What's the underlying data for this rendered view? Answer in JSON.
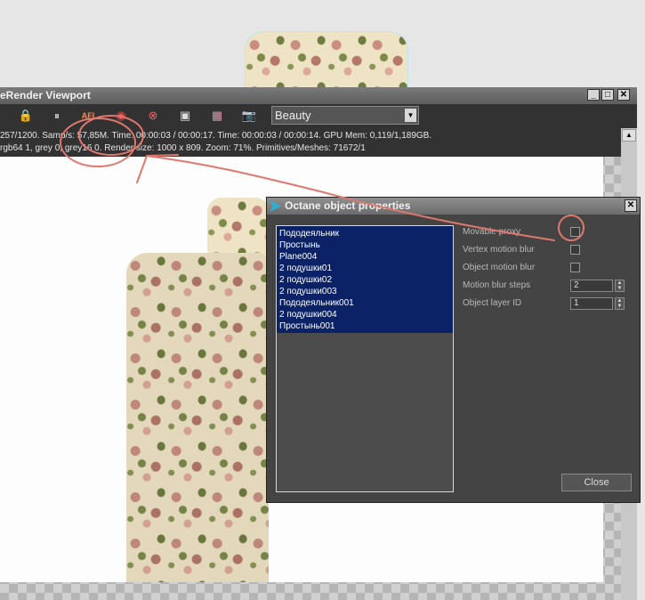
{
  "viewport": {
    "title": "eRender Viewport",
    "window_buttons": [
      "_",
      "□",
      "✕"
    ],
    "toolbar_icons": [
      "lock-icon",
      "pause-icon",
      "afi-icon",
      "color-wheel-icon",
      "no-region-icon",
      "monitor-icon",
      "film-icon",
      "camera-icon"
    ],
    "toolbar_glyphs": {
      "lock": "🔒",
      "pause": "⏸",
      "afi": "AFI",
      "color": "◉",
      "region": "⊗",
      "monitor": "▣",
      "film": "▦",
      "camera": "📷"
    },
    "pass_select": {
      "value": "Beauty",
      "arrow": "▼"
    },
    "status_line1": "257/1200.   Samp/s: 57,85M.   Time: 00:00:03 / 00:00:17.   Time: 00:00:03 / 00:00:14.   GPU Mem: 0,119/1,189GB.",
    "status_line2": "rgb64 1, grey 0, grey16 0.   Render size: 1000 x 809.   Zoom: 71%.   Primitives/Meshes: 71672/1",
    "scroll_up": "▲"
  },
  "dialog": {
    "title": "Octane object properties",
    "close_glyph": "✕",
    "objects": [
      "Пододеяльник",
      "Простынь",
      "Plane004",
      "2 подушки01",
      "2 подушки02",
      "2 подушки003",
      "Пододеяльник001",
      "2 подушки004",
      "Простынь001"
    ],
    "properties": {
      "movable_proxy": "Movable proxy",
      "vertex_motion_blur": "Vertex motion blur",
      "object_motion_blur": "Object motion blur",
      "motion_blur_steps": "Motion blur steps",
      "object_layer_id": "Object layer ID"
    },
    "motion_blur_steps_value": "2",
    "object_layer_id_value": "1",
    "spin_up": "▲",
    "spin_down": "▼",
    "close_button": "Close"
  },
  "colors": {
    "annotation": "#e0786e",
    "selection": "#0b2267",
    "window_bg": "#323232"
  }
}
